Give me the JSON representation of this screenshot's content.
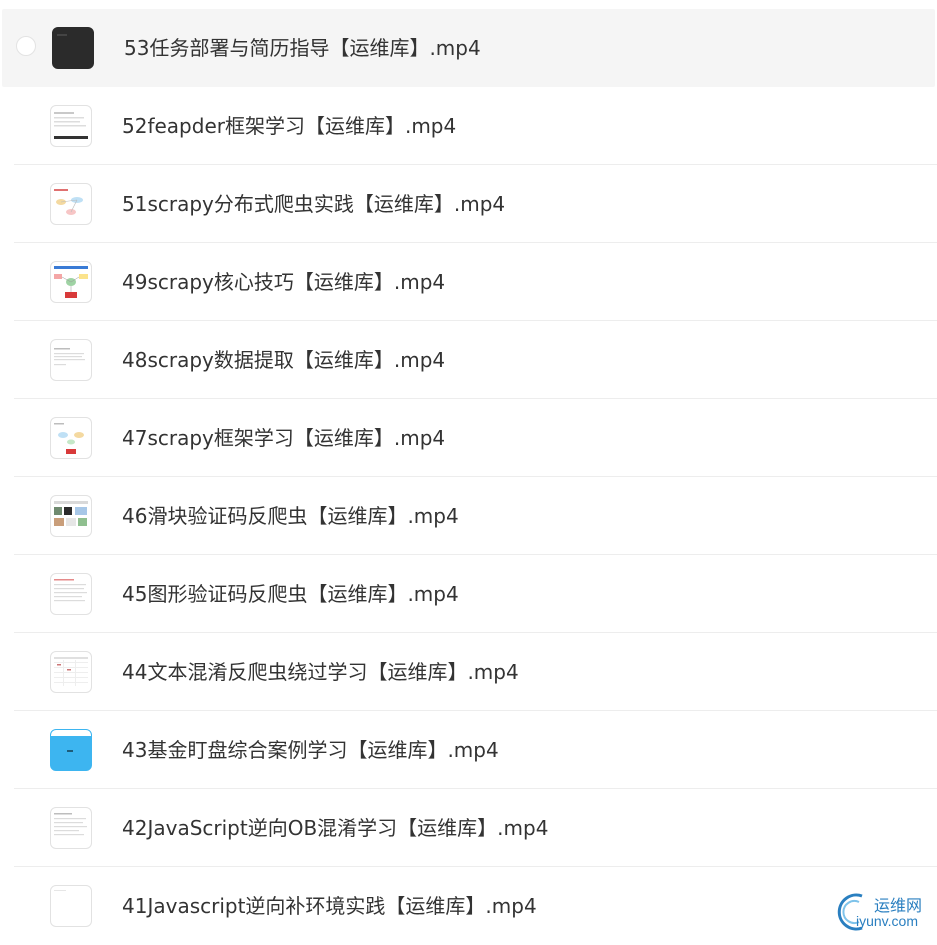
{
  "files": [
    {
      "name": "53任务部署与简历指导【运维库】.mp4",
      "thumb": "dark-thumbnail"
    },
    {
      "name": "52feapder框架学习【运维库】.mp4",
      "thumb": "document-thumbnail"
    },
    {
      "name": "51scrapy分布式爬虫实践【运维库】.mp4",
      "thumb": "diagram-thumbnail"
    },
    {
      "name": "49scrapy核心技巧【运维库】.mp4",
      "thumb": "mindmap-thumbnail"
    },
    {
      "name": "48scrapy数据提取【运维库】.mp4",
      "thumb": "document-thumbnail"
    },
    {
      "name": "47scrapy框架学习【运维库】.mp4",
      "thumb": "diagram-thumbnail"
    },
    {
      "name": "46滑块验证码反爬虫【运维库】.mp4",
      "thumb": "webpage-thumbnail"
    },
    {
      "name": "45图形验证码反爬虫【运维库】.mp4",
      "thumb": "document-thumbnail"
    },
    {
      "name": "44文本混淆反爬虫绕过学习【运维库】.mp4",
      "thumb": "table-thumbnail"
    },
    {
      "name": "43基金盯盘综合案例学习【运维库】.mp4",
      "thumb": "blue-thumbnail"
    },
    {
      "name": "42JavaScript逆向OB混淆学习【运维库】.mp4",
      "thumb": "document-thumbnail"
    },
    {
      "name": "41Javascript逆向补环境实践【运维库】.mp4",
      "thumb": "blank-thumbnail"
    }
  ],
  "watermark": {
    "cn": "运维网",
    "en": "iyunv.com"
  },
  "colors": {
    "text": "#333333",
    "hover_row": "#f5f5f5",
    "separator": "#ededed",
    "watermark": "#2a7fc0"
  }
}
